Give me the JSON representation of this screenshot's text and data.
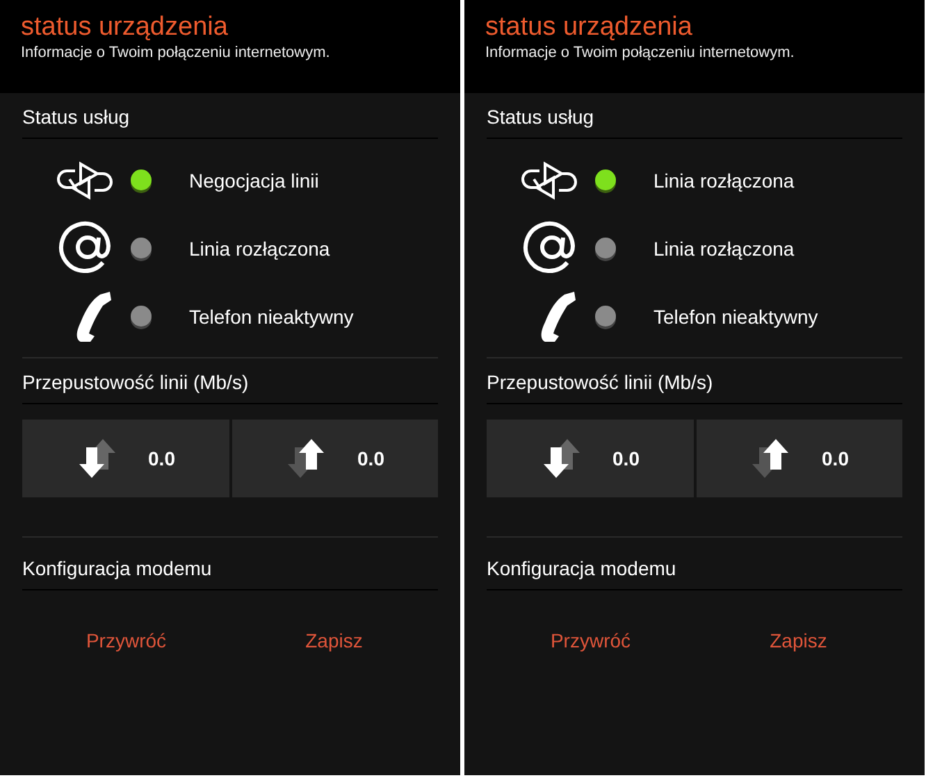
{
  "panels": [
    {
      "title": "status urządzenia",
      "subtitle": "Informacje o Twoim połączeniu internetowym.",
      "services_heading": "Status usług",
      "services": [
        {
          "kind": "sync",
          "active": true,
          "label": "Negocjacja linii"
        },
        {
          "kind": "email",
          "active": false,
          "label": "Linia rozłączona"
        },
        {
          "kind": "phone",
          "active": false,
          "label": "Telefon nieaktywny"
        }
      ],
      "throughput_heading": "Przepustowość linii (Mb/s)",
      "throughput": [
        {
          "kind": "download",
          "value": "0.0"
        },
        {
          "kind": "upload",
          "value": "0.0"
        }
      ],
      "config_heading": "Konfiguracja modemu",
      "actions": [
        "Przywróć",
        "Zapisz"
      ]
    },
    {
      "title": "status urządzenia",
      "subtitle": "Informacje o Twoim połączeniu internetowym.",
      "services_heading": "Status usług",
      "services": [
        {
          "kind": "sync",
          "active": true,
          "label": "Linia rozłączona"
        },
        {
          "kind": "email",
          "active": false,
          "label": "Linia rozłączona"
        },
        {
          "kind": "phone",
          "active": false,
          "label": "Telefon nieaktywny"
        }
      ],
      "throughput_heading": "Przepustowość linii (Mb/s)",
      "throughput": [
        {
          "kind": "download",
          "value": "0.0"
        },
        {
          "kind": "upload",
          "value": "0.0"
        }
      ],
      "config_heading": "Konfiguracja modemu",
      "actions": [
        "Przywróć",
        "Zapisz"
      ]
    }
  ]
}
